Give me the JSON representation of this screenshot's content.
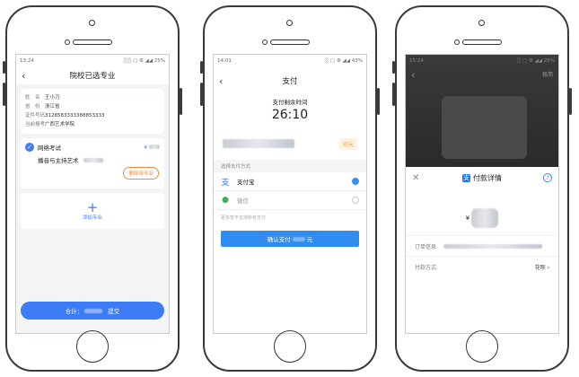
{
  "phone1": {
    "status_time": "13:24",
    "status_icons": "░░ ▢ ⚙ ◢◢ 25%",
    "title": "院校已选专业",
    "info": [
      {
        "key": "姓　名",
        "value": "王小刀"
      },
      {
        "key": "省　份",
        "value": "浙江省"
      },
      {
        "key": "证件号码",
        "value": "3128583333388853333"
      },
      {
        "key": "当前报考",
        "value": "广西艺术学院"
      }
    ],
    "exam_name": "网络考试",
    "exam_price_prefix": "¥",
    "major": "播音与主持艺术",
    "remove_label": "删除该专业",
    "add_label": "添加专业",
    "total_label": "合计：",
    "submit_label": "提交"
  },
  "phone2": {
    "status_time": "14:01",
    "status_icons": "░ ▢ ⚙ ◢◢ 43%",
    "title": "支付",
    "remaining_label": "支付剩余时间",
    "remaining_time": "26:10",
    "amount_badge": "元",
    "method_section": "选择支付方式",
    "methods": [
      {
        "name": "支付宝",
        "icon": "alipay-icon",
        "selected": true
      },
      {
        "name": "微信",
        "icon": "wechat-icon",
        "selected": false
      }
    ],
    "note": "更多暂不支持所有支付",
    "confirm_label_prefix": "确认支付",
    "confirm_label_suffix": "元"
  },
  "phone3": {
    "status_time": "15:24",
    "status_icons": "░ ▢ ⚙ ◢◢ 25%",
    "top_right": "极简",
    "sheet_title": "付款详情",
    "currency": "¥",
    "order_label": "订单信息",
    "pay_method_label": "付款方式",
    "pay_method_value": "花呗 ›"
  }
}
